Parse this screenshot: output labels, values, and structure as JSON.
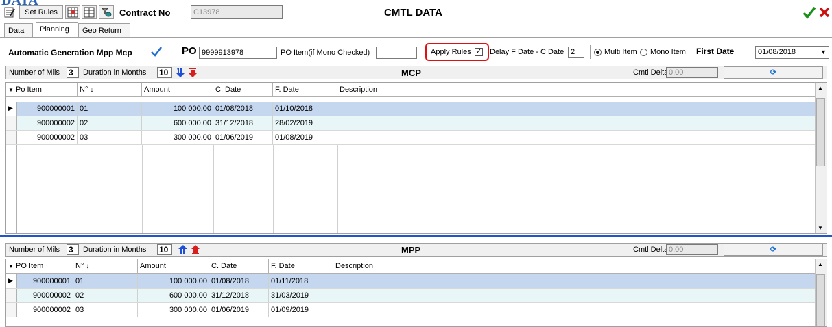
{
  "page_heading": "DATA",
  "toolbar": {
    "set_rules_label": "Set Rules",
    "contract_label": "Contract No",
    "contract_value": "C13978",
    "window_title": "CMTL DATA"
  },
  "tabs": [
    {
      "label": "Data"
    },
    {
      "label": "Planning"
    },
    {
      "label": "Geo Return"
    }
  ],
  "options_bar": {
    "auto_gen_label": "Automatic Generation Mpp Mcp",
    "po_label": "PO",
    "po_value": "9999913978",
    "po_item_label": "PO Item(if Mono Checked)",
    "po_item_value": "",
    "apply_rules_label": "Apply Rules",
    "apply_rules_checked": true,
    "delay_label": "Delay F Date - C Date",
    "delay_value": "2",
    "multi_item_label": "Multi Item",
    "mono_item_label": "Mono Item",
    "first_date_label": "First Date",
    "first_date_value": "01/08/2018"
  },
  "mcp": {
    "title": "MCP",
    "mils_label": "Number of Mils",
    "mils_value": "3",
    "duration_label": "Duration in Months",
    "duration_value": "10",
    "delta_label": "Cmtl Delta",
    "delta_value": "0.00",
    "columns": [
      "Po Item",
      "N°",
      "Amount",
      "C. Date",
      "F. Date",
      "Description"
    ],
    "rows": [
      {
        "po_item": "900000001",
        "n": "01",
        "amount": "100 000.00",
        "c_date": "01/08/2018",
        "f_date": "01/10/2018",
        "description": ""
      },
      {
        "po_item": "900000002",
        "n": "02",
        "amount": "600 000.00",
        "c_date": "31/12/2018",
        "f_date": "28/02/2019",
        "description": ""
      },
      {
        "po_item": "900000002",
        "n": "03",
        "amount": "300 000.00",
        "c_date": "01/06/2019",
        "f_date": "01/08/2019",
        "description": ""
      }
    ]
  },
  "mpp": {
    "title": "MPP",
    "mils_label": "Number of Mils",
    "mils_value": "3",
    "duration_label": "Duration in Months",
    "duration_value": "10",
    "delta_label": "Cmtl Delta",
    "delta_value": "0.00",
    "columns": [
      "PO Item",
      "N°",
      "Amount",
      "C. Date",
      "F. Date",
      "Description"
    ],
    "rows": [
      {
        "po_item": "900000001",
        "n": "01",
        "amount": "100 000.00",
        "c_date": "01/08/2018",
        "f_date": "01/11/2018",
        "description": ""
      },
      {
        "po_item": "900000002",
        "n": "02",
        "amount": "600 000.00",
        "c_date": "31/12/2018",
        "f_date": "31/03/2019",
        "description": ""
      },
      {
        "po_item": "900000002",
        "n": "03",
        "amount": "300 000.00",
        "c_date": "01/06/2019",
        "f_date": "01/09/2019",
        "description": ""
      }
    ]
  },
  "colors": {
    "accent_blue": "#2255cc",
    "ok_green": "#1a8f1a",
    "cancel_red": "#cc1111",
    "highlight_red": "#e01010"
  }
}
